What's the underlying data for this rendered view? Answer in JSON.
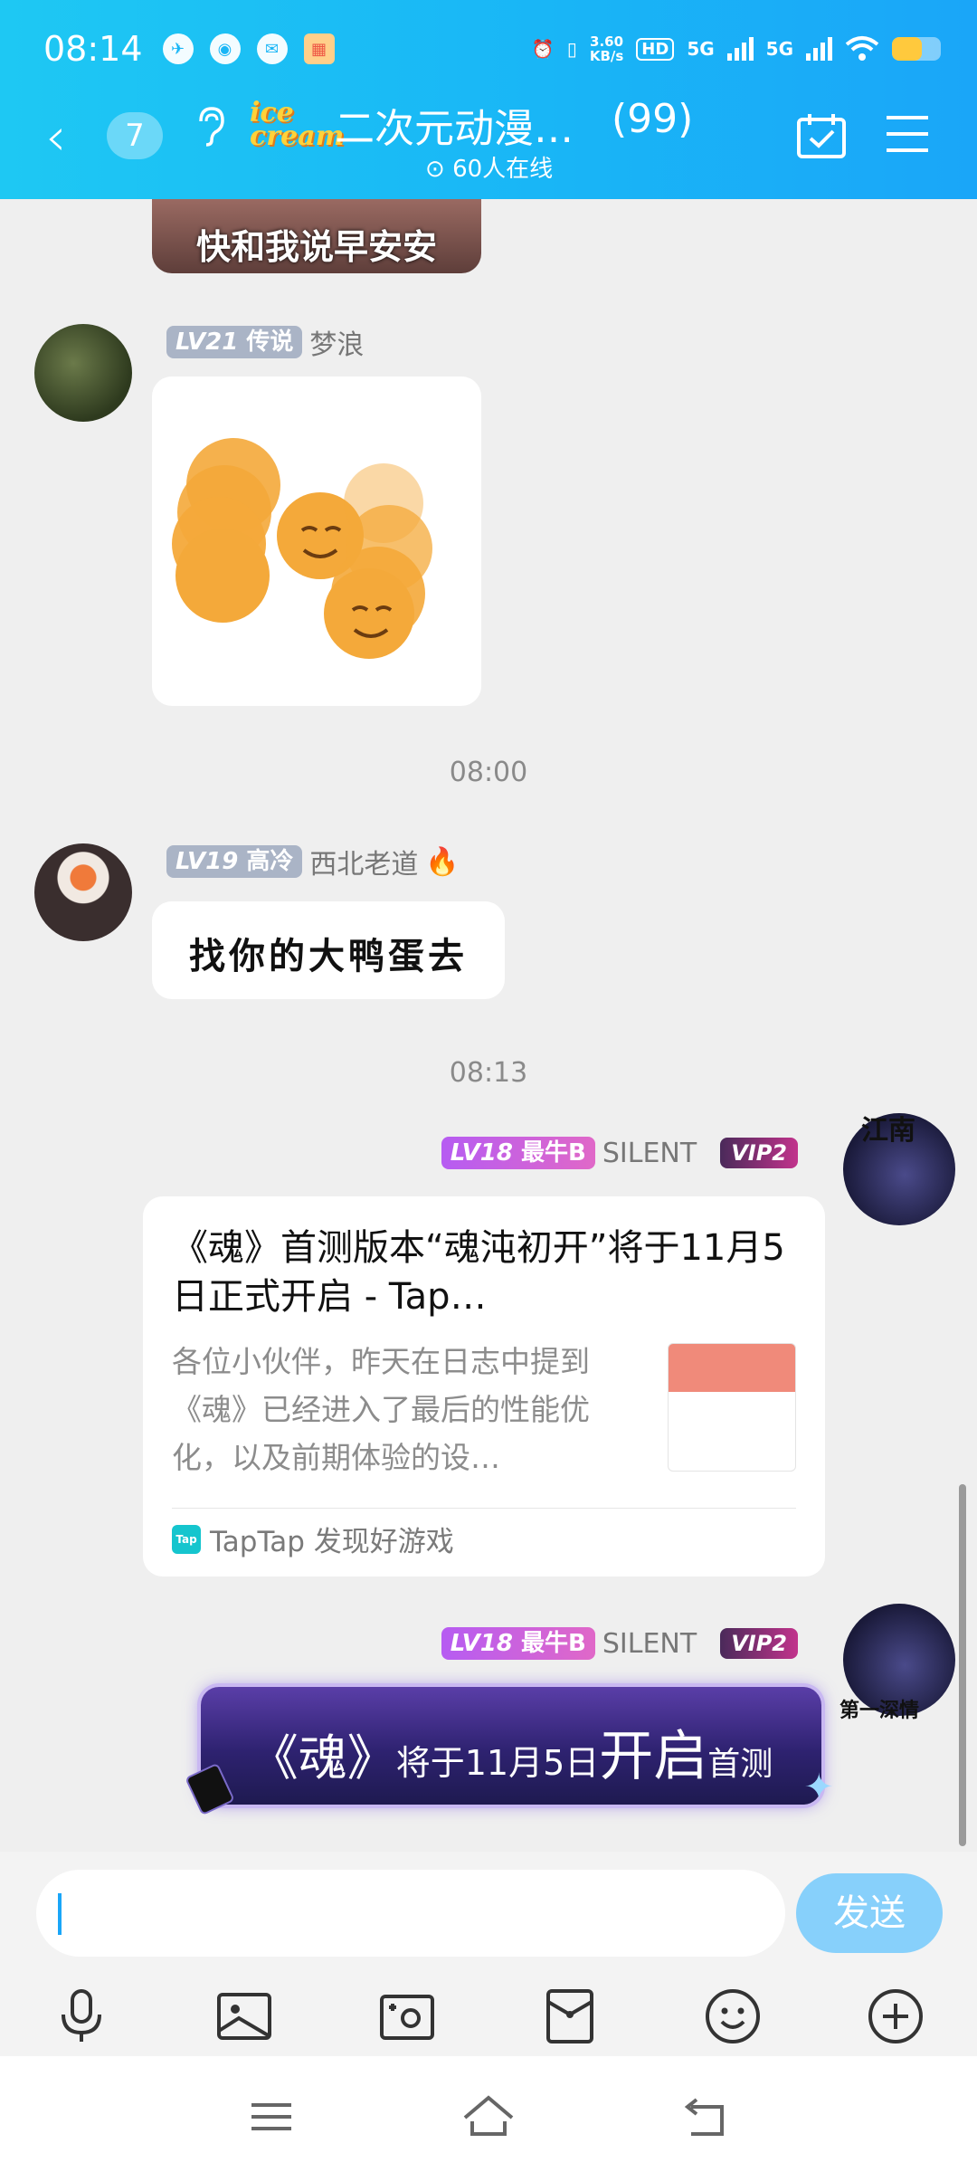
{
  "status_bar": {
    "time": "08:14",
    "speed_top": "3.60",
    "speed_bottom": "KB/s",
    "hd": "HD",
    "net1": "5G",
    "net2": "5G"
  },
  "header": {
    "back_badge": "7",
    "group_title": "二次元动漫…",
    "group_count": "(99)",
    "online": "60人在线",
    "logo_top": "ice",
    "logo_bottom": "cream"
  },
  "chat": {
    "top_sticker_text": "快和我说早安安",
    "msg1": {
      "level": "LV21",
      "title": "传说",
      "nick": "梦浪"
    },
    "time1": "08:00",
    "msg2": {
      "level": "LV19",
      "title": "高冷",
      "nick": "西北老道",
      "text": "找你的大鸭蛋去"
    },
    "time2": "08:13",
    "msg3": {
      "level": "LV18",
      "title": "最牛B",
      "nick": "SILENT",
      "vip": "VIP2",
      "card_title": "《魂》首测版本“魂沌初开”将于11月5日正式开启 - Tap…",
      "card_desc": "各位小伙伴，昨天在日志中提到《魂》已经进入了最后的性能优化，以及前期体验的设…",
      "card_source": "TapTap 发现好游戏",
      "source_icon": "Tap"
    },
    "msg4": {
      "level": "LV18",
      "title": "最牛B",
      "nick": "SILENT",
      "vip": "VIP2",
      "banner_a": "《魂》",
      "banner_b": "将于11月5日",
      "banner_c": "开启",
      "banner_d": "首测"
    },
    "avatar_text_1": "江南",
    "avatar_text_2": "第一深情"
  },
  "input": {
    "send_label": "发送"
  },
  "colors": {
    "accent": "#1ab2f6",
    "send_bg": "#87d0fb"
  },
  "icons": [
    "mic-icon",
    "image-icon",
    "camera-icon",
    "red-packet-icon",
    "emoji-icon",
    "plus-icon"
  ]
}
